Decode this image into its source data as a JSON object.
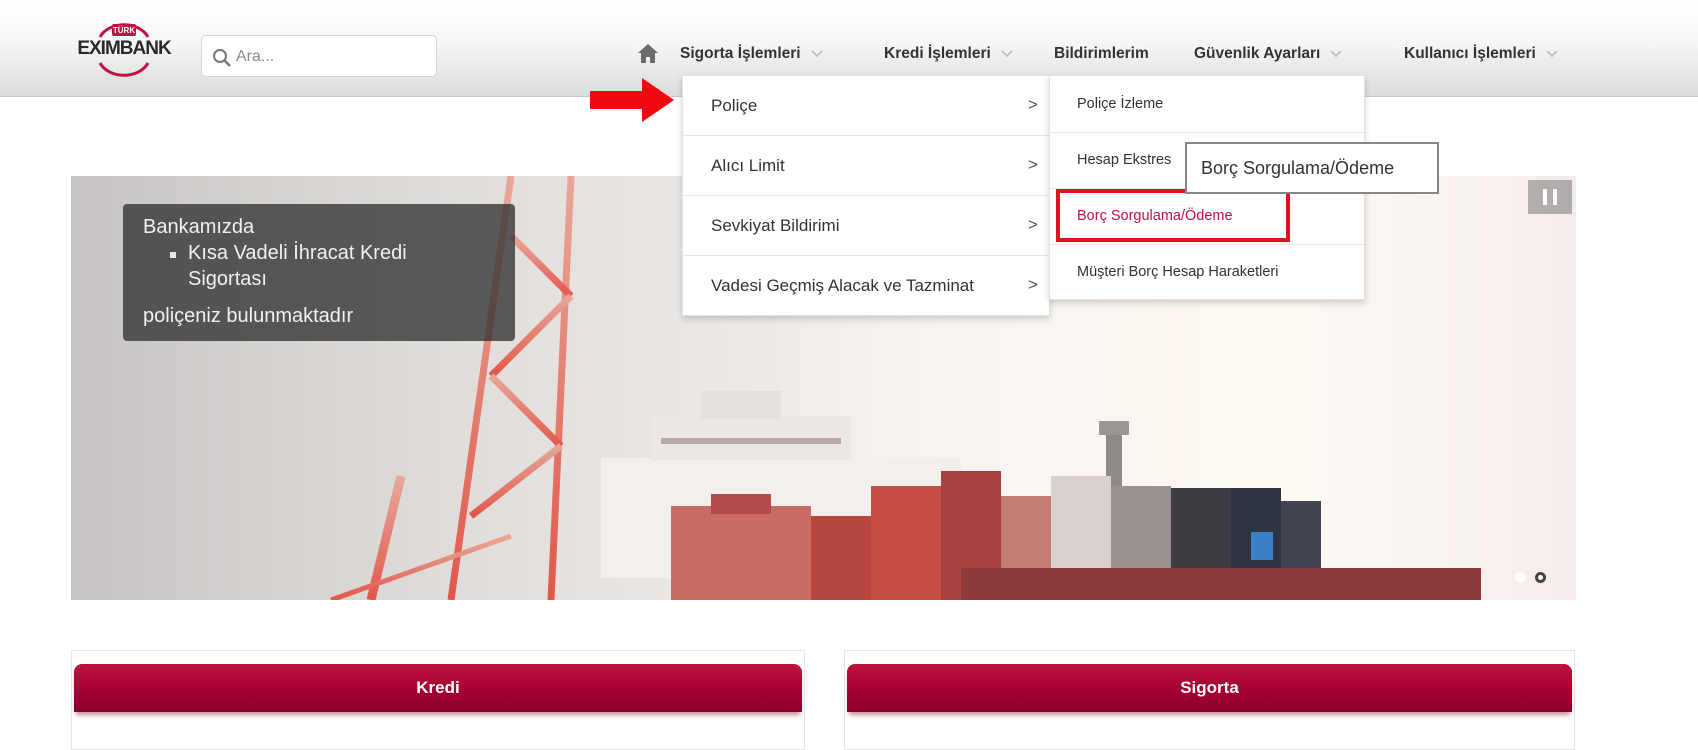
{
  "header": {
    "logo_text": "EXIMBANK",
    "logo_badge": "TÜRK",
    "search": {
      "placeholder": "Ara..."
    },
    "nav": [
      {
        "label": "Sigorta İşlemleri",
        "has_dropdown": true
      },
      {
        "label": "Kredi İşlemleri",
        "has_dropdown": true
      },
      {
        "label": "Bildirimlerim",
        "has_dropdown": false
      },
      {
        "label": "Güvenlik Ayarları",
        "has_dropdown": true
      },
      {
        "label": "Kullanıcı İşlemleri",
        "has_dropdown": true
      }
    ]
  },
  "menu_level1": [
    {
      "label": "Poliçe",
      "indicator": ">"
    },
    {
      "label": "Alıcı Limit",
      "indicator": ">"
    },
    {
      "label": "Sevkiyat Bildirimi",
      "indicator": ">"
    },
    {
      "label": "Vadesi Geçmiş Alacak ve Tazminat",
      "indicator": ">"
    }
  ],
  "menu_level2": [
    {
      "label": "Poliçe İzleme"
    },
    {
      "label": "Hesap Ekstres"
    },
    {
      "label": "Borç Sorgulama/Ödeme",
      "active": true
    },
    {
      "label": "Müşteri Borç Hesap Haraketleri"
    }
  ],
  "tooltip": "Borç Sorgulama/Ödeme",
  "banner": {
    "caption_line1": "Bankamızda",
    "caption_bullet_line1": "Kısa Vadeli İhracat Kredi",
    "caption_bullet_line2": "Sigortası",
    "caption_line2": "poliçeniz bulunmaktadır",
    "slide_count": 2,
    "active_slide": 2
  },
  "panels": [
    {
      "title": "Kredi"
    },
    {
      "title": "Sigorta"
    }
  ],
  "colors": {
    "accent": "#a10030",
    "active_link": "#c20e4b",
    "highlight_border": "#e40f1f",
    "arrow": "#ee0a10"
  },
  "icons": [
    "search-icon",
    "home-icon",
    "chevron-down-icon",
    "chevron-right-icon",
    "pause-icon",
    "red-arrow-icon"
  ]
}
